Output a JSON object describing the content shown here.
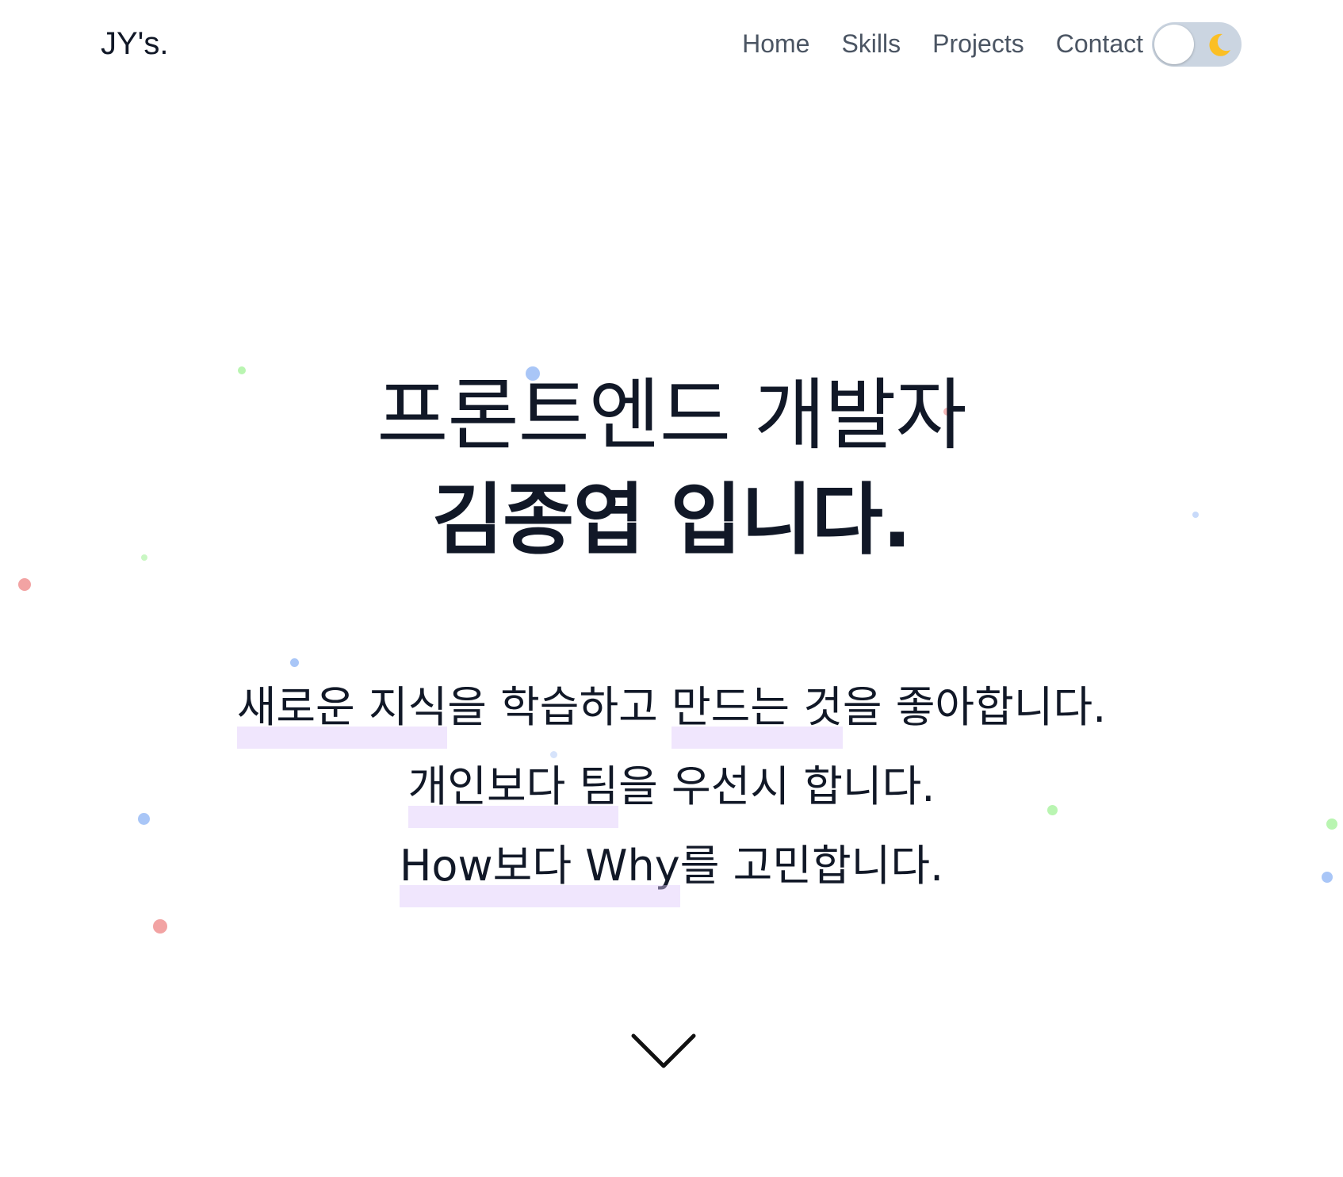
{
  "header": {
    "logo": "JY's.",
    "nav": [
      "Home",
      "Skills",
      "Projects",
      "Contact"
    ]
  },
  "theme_toggle": {
    "icon": "moon-icon",
    "state": "light"
  },
  "hero": {
    "line1": "프론트엔드 개발자",
    "name": "김종엽",
    "line2_suffix": " 입니다."
  },
  "intro": {
    "line1_hl1": "새로운 지식",
    "line1_mid": "을 학습하고 ",
    "line1_hl2": "만드는 것",
    "line1_end": "을 좋아합니다.",
    "line2_hl": "개인보다 팀",
    "line2_end": "을 우선시 합니다.",
    "line3_hl": "How보다 Why",
    "line3_end": "를 고민합니다."
  },
  "colors": {
    "text": "#111827",
    "nav": "#4b5563",
    "highlight": "#e9ddfb",
    "toggle_bg": "#cbd5e1",
    "moon": "#fbbf24",
    "dot_blue": "#93b7f5",
    "dot_green": "#a7f3a0",
    "dot_red": "#f2a3a3"
  },
  "scroll_icon": "chevron-down-icon"
}
